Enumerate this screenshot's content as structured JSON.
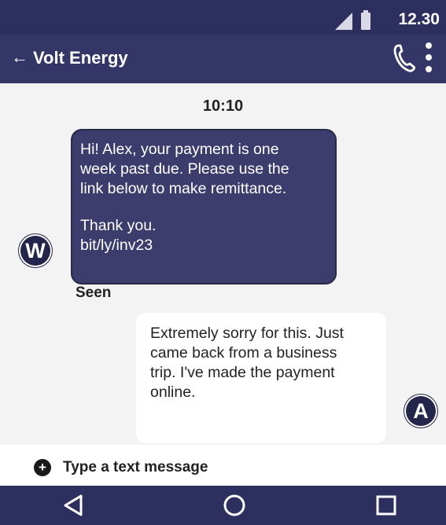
{
  "status_bar": {
    "time": "12.30",
    "icons": [
      "signal-icon",
      "battery-icon"
    ]
  },
  "header": {
    "back_icon": "←",
    "title": "Volt Energy",
    "icons": [
      "phone-icon",
      "more-vert-icon"
    ]
  },
  "chat": {
    "timestamp": "10:10",
    "incoming": {
      "avatar_letter": "W",
      "lines": [
        "Hi! Alex, your payment is one",
        "week past due. Please use the",
        "link below to make remittance."
      ],
      "closing": "Thank you.",
      "link": "bit/ly/inv23"
    },
    "seen_label": "Seen",
    "outgoing": {
      "avatar_letter": "A",
      "lines": [
        "Extremely sorry for this. Just",
        "came back from a business",
        "trip. I've made the payment",
        "online."
      ]
    }
  },
  "composer": {
    "plus_icon": "+",
    "placeholder": "Type a text message"
  },
  "nav_bar": {
    "icons": [
      "back-triangle-icon",
      "home-circle-icon",
      "recents-square-icon"
    ]
  },
  "colors": {
    "bar": "#2d2f5e",
    "incoming_bubble": "#3c3d6d",
    "chat_background": "#f3f3f3"
  }
}
